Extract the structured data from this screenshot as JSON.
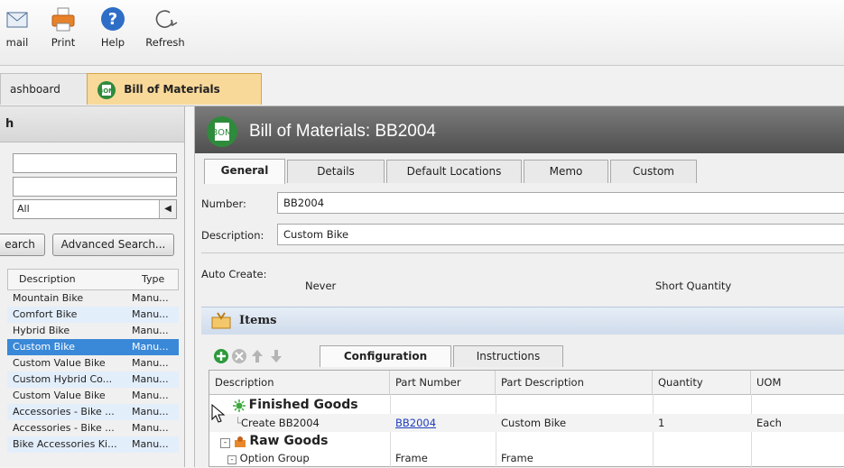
{
  "toolbar": {
    "buttons": [
      {
        "label": "mail",
        "icon": "email-icon"
      },
      {
        "label": "Print",
        "icon": "printer-icon"
      },
      {
        "label": "Help",
        "icon": "help-icon"
      },
      {
        "label": "Refresh",
        "icon": "refresh-icon"
      }
    ]
  },
  "page_tabs": {
    "dashboard": "ashboard",
    "bom": "Bill of Materials"
  },
  "search_panel": {
    "title": "h",
    "select_value": "All",
    "search_button": "earch",
    "advanced_button": "Advanced Search...",
    "columns": [
      "Description",
      "Type"
    ],
    "rows": [
      [
        "Mountain Bike",
        "Manu..."
      ],
      [
        "Comfort Bike",
        "Manu..."
      ],
      [
        "Hybrid Bike",
        "Manu..."
      ],
      [
        "Custom Bike",
        "Manu..."
      ],
      [
        "Custom Value Bike",
        "Manu..."
      ],
      [
        "Custom Hybrid Co...",
        "Manu..."
      ],
      [
        "Custom Value Bike",
        "Manu..."
      ],
      [
        "Accessories - Bike ...",
        "Manu..."
      ],
      [
        "Accessories - Bike ...",
        "Manu..."
      ],
      [
        "Bike Accessories Ki...",
        "Manu..."
      ]
    ],
    "selected_row": "Custom Bike"
  },
  "detail": {
    "title": "Bill of Materials: BB2004",
    "tabs": [
      "General",
      "Details",
      "Default Locations",
      "Memo",
      "Custom"
    ],
    "number_label": "Number:",
    "number_value": "BB2004",
    "description_label": "Description:",
    "description_value": "Custom Bike",
    "auto_create_label": "Auto Create:",
    "auto_create_value": "Never",
    "short_quantity_label": "Short Quantity",
    "items_title": "Items",
    "item_tabs": [
      "Configuration",
      "Instructions"
    ],
    "grid_columns": [
      "Description",
      "Part Number",
      "Part Description",
      "Quantity",
      "UOM"
    ],
    "grid": {
      "finished_goods": "Finished Goods",
      "create_row": {
        "description": "Create BB2004",
        "part_number": "BB2004",
        "part_description": "Custom Bike",
        "quantity": "1",
        "uom": "Each"
      },
      "raw_goods": "Raw Goods",
      "option_row": {
        "description": "Option Group",
        "part_number": "Frame",
        "part_description": "Frame"
      }
    }
  },
  "colors": {
    "accent_tab": "#f9d99a",
    "title_bar": "#5f5f5f",
    "selected_row": "#3a88d8",
    "items_bar": "#d6e1ee"
  }
}
